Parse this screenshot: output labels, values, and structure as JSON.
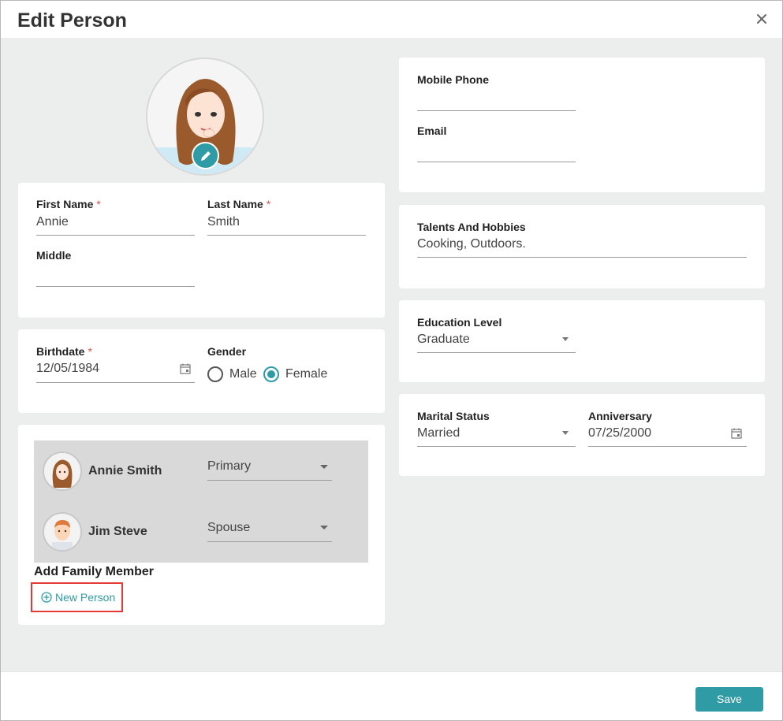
{
  "dialog": {
    "title": "Edit Person",
    "close_icon": "close-icon",
    "save_label": "Save",
    "accent_color": "#2f9ba5"
  },
  "avatar": {
    "icon": "avatar-female",
    "edit_icon": "pencil-icon"
  },
  "name": {
    "first_label": "First Name",
    "first_value": "Annie",
    "last_label": "Last Name",
    "last_value": "Smith",
    "middle_label": "Middle",
    "middle_value": "",
    "required_mark": "*"
  },
  "birth": {
    "birthdate_label": "Birthdate",
    "birthdate_value": "12/05/1984",
    "gender_label": "Gender",
    "gender_options": [
      "Male",
      "Female"
    ],
    "gender_selected": "Female",
    "calendar_icon": "calendar-icon"
  },
  "family": {
    "members": [
      {
        "name": "Annie Smith",
        "role": "Primary"
      },
      {
        "name": "Jim Steve",
        "role": "Spouse"
      }
    ],
    "add_title": "Add Family Member",
    "new_person_label": "New Person",
    "new_person_icon": "plus-circle-icon"
  },
  "contact": {
    "mobile_label": "Mobile Phone",
    "mobile_value": "",
    "email_label": "Email",
    "email_value": ""
  },
  "talents": {
    "label": "Talents And Hobbies",
    "value": "Cooking, Outdoors."
  },
  "education": {
    "label": "Education Level",
    "value": "Graduate"
  },
  "marital": {
    "status_label": "Marital Status",
    "status_value": "Married",
    "anniversary_label": "Anniversary",
    "anniversary_value": "07/25/2000"
  }
}
